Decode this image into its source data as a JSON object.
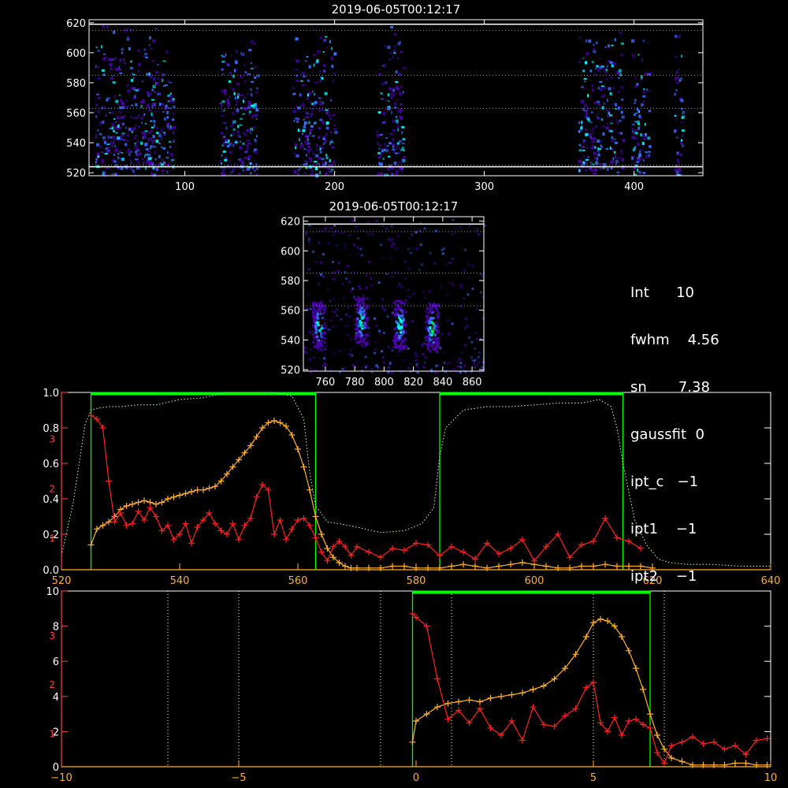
{
  "chart_data": [
    {
      "type": "heatmap",
      "title": "2019-06-05T00:12:17",
      "xlim": [
        36,
        446
      ],
      "ylim": [
        518,
        622
      ],
      "x_ticks": [
        "100",
        "200",
        "300",
        "400"
      ],
      "x_tick_values": [
        100,
        200,
        300,
        400
      ],
      "y_ticks": [
        "520",
        "540",
        "560",
        "580",
        "600",
        "620"
      ],
      "y_tick_values": [
        520,
        540,
        560,
        580,
        600,
        620
      ],
      "hlines_dotted": [
        525,
        563,
        585,
        615
      ],
      "hlines_solid": [
        524,
        619
      ],
      "column_bands": [
        [
          40,
          92
        ],
        [
          123,
          148
        ],
        [
          172,
          200
        ],
        [
          228,
          246
        ],
        [
          362,
          392
        ],
        [
          398,
          410
        ],
        [
          426,
          432
        ]
      ],
      "colors": {
        "frame": "#ffffff",
        "guide": "#00ff00",
        "low": "#4b00b0",
        "mid": "#3a70ff",
        "high": "#00ffff"
      }
    },
    {
      "type": "heatmap",
      "title": "2019-06-05T00:12:17",
      "xlim": [
        745,
        868
      ],
      "ylim": [
        519,
        623
      ],
      "x_ticks": [
        "760",
        "780",
        "800",
        "820",
        "840",
        "860"
      ],
      "x_tick_values": [
        760,
        780,
        800,
        820,
        840,
        860
      ],
      "y_ticks": [
        "520",
        "540",
        "560",
        "580",
        "600",
        "620"
      ],
      "y_tick_values": [
        520,
        540,
        560,
        580,
        600,
        620
      ],
      "hlines_dotted": [
        563,
        585,
        613
      ],
      "hlines_solid": [
        618
      ],
      "hot_spots": [
        [
          755,
          550
        ],
        [
          784,
          553
        ],
        [
          810,
          551
        ],
        [
          832,
          549
        ]
      ],
      "colors": {
        "frame": "#ffffff",
        "guide": "#00ff00",
        "low": "#4b00b0",
        "mid": "#3a70ff",
        "high": "#00ffff",
        "peak": "#00ff40"
      }
    },
    {
      "type": "line",
      "xlim": [
        520,
        640
      ],
      "ylim": [
        0,
        1
      ],
      "x_ticks": [
        "520",
        "540",
        "560",
        "580",
        "600",
        "620",
        "640"
      ],
      "x_tick_values": [
        520,
        540,
        560,
        580,
        600,
        620,
        640
      ],
      "y_ticks": [
        "0.0",
        "0.2",
        "0.4",
        "0.6",
        "0.8",
        "1.0"
      ],
      "y_tick_values": [
        0,
        0.2,
        0.4,
        0.6,
        0.8,
        1.0
      ],
      "right_axis_ticks": [
        "1",
        "2",
        "3"
      ],
      "right_axis_tick_values": [
        0.18,
        0.46,
        0.74
      ],
      "windows": [
        [
          525,
          563
        ],
        [
          584,
          615
        ]
      ],
      "series": [
        {
          "style": "dotted",
          "color": "#c8ffc8",
          "x": [
            520,
            522,
            524,
            525,
            526,
            528,
            530,
            533,
            536,
            540,
            544,
            548,
            552,
            556,
            559,
            561,
            562,
            563,
            565,
            567,
            570,
            574,
            578,
            581,
            583,
            584,
            585,
            588,
            592,
            596,
            600,
            604,
            608,
            611,
            613,
            614,
            615,
            617,
            619,
            621,
            623,
            626,
            630,
            635,
            640
          ],
          "y": [
            0.08,
            0.38,
            0.82,
            0.9,
            0.91,
            0.92,
            0.92,
            0.93,
            0.93,
            0.96,
            0.97,
            1.0,
            1.0,
            1.0,
            0.98,
            0.85,
            0.55,
            0.36,
            0.27,
            0.26,
            0.24,
            0.21,
            0.22,
            0.26,
            0.35,
            0.64,
            0.8,
            0.9,
            0.92,
            0.92,
            0.93,
            0.94,
            0.94,
            0.96,
            0.92,
            0.8,
            0.6,
            0.28,
            0.14,
            0.06,
            0.04,
            0.03,
            0.03,
            0.02,
            0.02
          ]
        },
        {
          "style": "line+plus",
          "color": "#ffb030",
          "x": [
            525,
            526,
            527,
            528,
            529,
            530,
            531,
            532,
            533,
            534,
            535,
            536,
            537,
            538,
            539,
            540,
            541,
            542,
            543,
            544,
            545,
            546,
            547,
            548,
            549,
            550,
            551,
            552,
            553,
            554,
            555,
            556,
            557,
            558,
            559,
            560,
            561,
            562,
            563,
            564,
            565,
            566,
            567,
            568,
            569,
            570,
            572,
            574,
            576,
            578,
            580,
            582,
            584,
            586,
            588,
            590,
            592,
            594,
            596,
            598,
            600,
            602,
            604,
            606,
            608,
            610,
            612,
            614,
            616,
            618,
            620
          ],
          "y": [
            0.14,
            0.23,
            0.25,
            0.27,
            0.3,
            0.34,
            0.36,
            0.37,
            0.38,
            0.39,
            0.38,
            0.37,
            0.38,
            0.4,
            0.41,
            0.42,
            0.43,
            0.44,
            0.45,
            0.45,
            0.46,
            0.47,
            0.5,
            0.54,
            0.58,
            0.62,
            0.66,
            0.7,
            0.75,
            0.8,
            0.83,
            0.84,
            0.83,
            0.81,
            0.76,
            0.68,
            0.58,
            0.45,
            0.3,
            0.2,
            0.12,
            0.07,
            0.04,
            0.02,
            0.01,
            0.01,
            0.01,
            0.01,
            0.02,
            0.02,
            0.01,
            0.01,
            0.01,
            0.02,
            0.03,
            0.02,
            0.01,
            0.02,
            0.03,
            0.04,
            0.03,
            0.02,
            0.01,
            0.01,
            0.02,
            0.02,
            0.03,
            0.02,
            0.02,
            0.02,
            0.01
          ]
        },
        {
          "style": "line+plus",
          "color": "#ff2020",
          "x": [
            525,
            526,
            527,
            528,
            529,
            530,
            531,
            532,
            533,
            534,
            535,
            536,
            537,
            538,
            539,
            540,
            541,
            542,
            543,
            544,
            545,
            546,
            547,
            548,
            549,
            550,
            551,
            552,
            553,
            554,
            555,
            556,
            557,
            558,
            559,
            560,
            561,
            562,
            563,
            564,
            565,
            566,
            567,
            568,
            569,
            570,
            572,
            574,
            576,
            578,
            580,
            582,
            584,
            586,
            588,
            590,
            592,
            594,
            596,
            598,
            600,
            602,
            604,
            606,
            608,
            610,
            612,
            614,
            616,
            618
          ],
          "y": [
            0.87,
            0.85,
            0.8,
            0.5,
            0.27,
            0.32,
            0.25,
            0.26,
            0.33,
            0.28,
            0.35,
            0.3,
            0.22,
            0.25,
            0.17,
            0.2,
            0.26,
            0.15,
            0.24,
            0.28,
            0.32,
            0.26,
            0.22,
            0.2,
            0.26,
            0.17,
            0.25,
            0.29,
            0.41,
            0.48,
            0.45,
            0.2,
            0.28,
            0.17,
            0.23,
            0.28,
            0.29,
            0.25,
            0.18,
            0.1,
            0.05,
            0.13,
            0.16,
            0.13,
            0.08,
            0.13,
            0.1,
            0.07,
            0.12,
            0.11,
            0.15,
            0.14,
            0.08,
            0.13,
            0.1,
            0.06,
            0.15,
            0.09,
            0.12,
            0.17,
            0.05,
            0.13,
            0.2,
            0.07,
            0.14,
            0.16,
            0.29,
            0.18,
            0.16,
            0.12
          ]
        }
      ],
      "colors": {
        "frame": "#ffffff",
        "left_axis": "#ff4040",
        "right_axis": "#ff4040",
        "x_axis": "#ffb030",
        "window": "#00ff00"
      }
    },
    {
      "type": "line",
      "xlim": [
        -10,
        10
      ],
      "ylim": [
        0,
        10
      ],
      "x_ticks": [
        "−10",
        "−5",
        "0",
        "5",
        "10"
      ],
      "x_tick_values": [
        -10,
        -5,
        0,
        5,
        10
      ],
      "y_ticks": [
        "0",
        "2",
        "4",
        "6",
        "8",
        "10"
      ],
      "y_tick_values": [
        0,
        2,
        4,
        6,
        8,
        10
      ],
      "right_axis_ticks": [
        "1",
        "2",
        "3"
      ],
      "right_axis_tick_values": [
        1.9,
        4.7,
        7.5
      ],
      "vlines_dotted": [
        -7,
        -5,
        -1,
        1,
        5,
        7
      ],
      "window": [
        -0.1,
        6.6
      ],
      "series": [
        {
          "style": "line+plus",
          "color": "#ffb030",
          "x": [
            -0.1,
            0,
            0.3,
            0.6,
            0.9,
            1.2,
            1.5,
            1.8,
            2.1,
            2.4,
            2.7,
            3.0,
            3.3,
            3.6,
            3.9,
            4.2,
            4.5,
            4.8,
            5.0,
            5.2,
            5.4,
            5.6,
            5.8,
            6.0,
            6.2,
            6.4,
            6.6,
            6.8,
            7.0,
            7.2,
            7.5,
            7.8,
            8.1,
            8.4,
            8.7,
            9.0,
            9.3,
            9.6,
            9.9
          ],
          "y": [
            1.4,
            2.6,
            3.0,
            3.4,
            3.6,
            3.7,
            3.8,
            3.7,
            3.9,
            4.0,
            4.1,
            4.2,
            4.4,
            4.6,
            5.0,
            5.6,
            6.4,
            7.4,
            8.2,
            8.4,
            8.3,
            8.0,
            7.4,
            6.6,
            5.6,
            4.4,
            3.0,
            1.8,
            1.0,
            0.5,
            0.3,
            0.1,
            0.1,
            0.1,
            0.1,
            0.2,
            0.2,
            0.1,
            0.1
          ]
        },
        {
          "style": "line+plus",
          "color": "#ff2020",
          "x": [
            -0.1,
            0,
            0.3,
            0.6,
            0.9,
            1.2,
            1.5,
            1.8,
            2.1,
            2.4,
            2.7,
            3.0,
            3.3,
            3.6,
            3.9,
            4.2,
            4.5,
            4.8,
            5.0,
            5.2,
            5.4,
            5.6,
            5.8,
            6.0,
            6.2,
            6.4,
            6.6,
            6.8,
            7.0,
            7.2,
            7.5,
            7.8,
            8.1,
            8.4,
            8.7,
            9.0,
            9.3,
            9.6,
            9.9
          ],
          "y": [
            8.7,
            8.5,
            8.0,
            5.0,
            2.7,
            3.2,
            2.5,
            3.3,
            2.2,
            1.8,
            2.6,
            1.5,
            3.4,
            2.4,
            2.3,
            2.9,
            3.3,
            4.5,
            4.8,
            2.5,
            2.0,
            2.8,
            1.8,
            2.6,
            2.7,
            2.4,
            2.2,
            0.8,
            0.2,
            1.2,
            1.4,
            1.7,
            1.3,
            1.4,
            1.0,
            1.2,
            0.7,
            1.5,
            1.6
          ]
        }
      ],
      "colors": {
        "frame": "#ffffff",
        "left_axis": "#ff4040",
        "right_axis": "#ff4040",
        "x_axis": "#ffb030",
        "window": "#00ff00",
        "vline": "#ffffc0"
      }
    }
  ],
  "info_panel": {
    "int": "Int      10",
    "fwhm": "fwhm    4.56",
    "sn": "sn       7.38",
    "gaussfit": "gaussfit  0",
    "ipt_c": "ipt_c   −1",
    "ipt1": "ipt1    −1",
    "ipt2": "ipt2    −1"
  }
}
